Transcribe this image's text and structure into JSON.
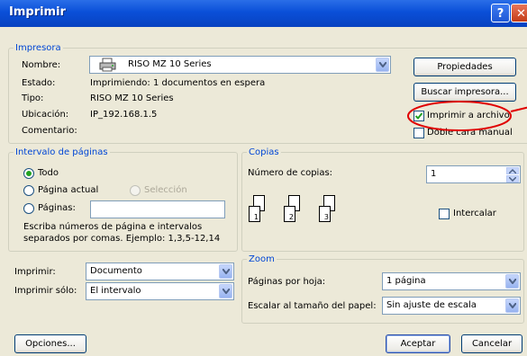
{
  "window": {
    "title": "Imprimir",
    "help_glyph": "?",
    "close_glyph": "✕"
  },
  "printer": {
    "legend": "Impresora",
    "name_label": "Nombre:",
    "name_value": "RISO MZ 10 Series",
    "status_label": "Estado:",
    "status_value": "Imprimiendo: 1 documentos en espera",
    "type_label": "Tipo:",
    "type_value": "RISO MZ 10 Series",
    "location_label": "Ubicación:",
    "location_value": "IP_192.168.1.5",
    "comment_label": "Comentario:",
    "properties_button": "Propiedades",
    "find_printer_button": "Buscar impresora...",
    "print_to_file_label": "Imprimir a archivo",
    "print_to_file_checked": true,
    "duplex_label": "Doble cara manual",
    "duplex_checked": false
  },
  "range": {
    "legend": "Intervalo de páginas",
    "all_label": "Todo",
    "current_label": "Página actual",
    "selection_label": "Selección",
    "pages_label": "Páginas:",
    "pages_value": "",
    "hint_line1": "Escriba números de página e intervalos",
    "hint_line2": "separados por comas. Ejemplo: 1,3,5-12,14",
    "selected": "all"
  },
  "copies": {
    "legend": "Copias",
    "count_label": "Número de copias:",
    "count_value": "1",
    "collate_label": "Intercalar",
    "collate_checked": false,
    "page_numbers": [
      "1",
      "2",
      "3"
    ]
  },
  "print_what": {
    "label": "Imprimir:",
    "value": "Documento",
    "print_only_label": "Imprimir sólo:",
    "print_only_value": "El intervalo"
  },
  "zoom": {
    "legend": "Zoom",
    "pages_per_sheet_label": "Páginas por hoja:",
    "pages_per_sheet_value": "1 página",
    "scale_label": "Escalar al tamaño del papel:",
    "scale_value": "Sin ajuste de escala"
  },
  "buttons": {
    "options": "Opciones...",
    "ok": "Aceptar",
    "cancel": "Cancelar"
  },
  "colors": {
    "title_bar": "#0a4fd8",
    "legend_text": "#0046d5",
    "annotation": "#e00000",
    "radio_dot": "#21a121"
  }
}
